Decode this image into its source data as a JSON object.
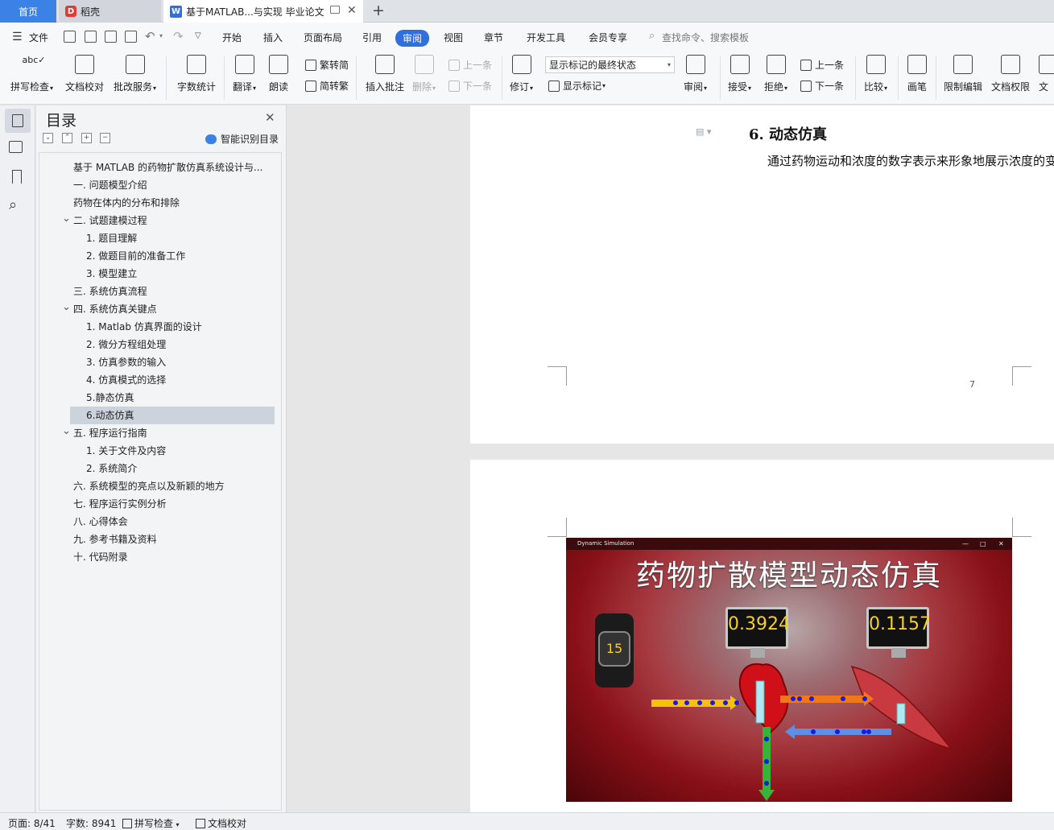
{
  "tabs": {
    "home": "首页",
    "daoke": "稻壳",
    "doc": "基于MATLAB...与实现 毕业论文",
    "add": "+"
  },
  "menu": {
    "file": "文件",
    "items": [
      "开始",
      "插入",
      "页面布局",
      "引用",
      "审阅",
      "视图",
      "章节",
      "开发工具",
      "会员专享"
    ],
    "active": "审阅",
    "search_placeholder": "查找命令、搜索模板"
  },
  "ribbon": {
    "spell": "拼写检查",
    "proofread": "文档校对",
    "batch": "批改服务",
    "wordcount": "字数统计",
    "translate": "翻译",
    "read": "朗读",
    "to_simp": "繁转简",
    "to_trad": "简转繁",
    "insert_comment": "插入批注",
    "delete": "删除",
    "prev_comment": "上一条",
    "next_comment": "下一条",
    "revise": "修订",
    "markup_state": "显示标记的最终状态",
    "show_markup": "显示标记",
    "review": "审阅",
    "accept": "接受",
    "reject": "拒绝",
    "prev": "上一条",
    "next": "下一条",
    "compare": "比较",
    "pen": "画笔",
    "restrict": "限制编辑",
    "permission": "文档权限",
    "doc_cut": "文"
  },
  "toc": {
    "title": "目录",
    "smart": "智能识别目录",
    "items": [
      {
        "text": "基于 MATLAB 的药物扩散仿真系统设计与...",
        "level": 0,
        "arrow": false
      },
      {
        "text": "一.   问题模型介绍",
        "level": 0,
        "arrow": false
      },
      {
        "text": "药物在体内的分布和排除",
        "level": 0,
        "arrow": false
      },
      {
        "text": "二. 试题建模过程",
        "level": 0,
        "arrow": true
      },
      {
        "text": "1. 题目理解",
        "level": 1,
        "arrow": false
      },
      {
        "text": "2. 做题目前的准备工作",
        "level": 1,
        "arrow": false
      },
      {
        "text": "3. 模型建立",
        "level": 1,
        "arrow": false
      },
      {
        "text": "三. 系统仿真流程",
        "level": 0,
        "arrow": false
      },
      {
        "text": "四. 系统仿真关键点",
        "level": 0,
        "arrow": true
      },
      {
        "text": "1. Matlab 仿真界面的设计",
        "level": 1,
        "arrow": false
      },
      {
        "text": "2. 微分方程组处理",
        "level": 1,
        "arrow": false
      },
      {
        "text": "3. 仿真参数的输入",
        "level": 1,
        "arrow": false
      },
      {
        "text": "4. 仿真模式的选择",
        "level": 1,
        "arrow": false
      },
      {
        "text": "5.静态仿真",
        "level": 1,
        "arrow": false
      },
      {
        "text": "6.动态仿真",
        "level": 1,
        "arrow": false,
        "selected": true
      },
      {
        "text": "五. 程序运行指南",
        "level": 0,
        "arrow": true
      },
      {
        "text": "1. 关于文件及内容",
        "level": 1,
        "arrow": false
      },
      {
        "text": "2. 系统简介",
        "level": 1,
        "arrow": false
      },
      {
        "text": "六. 系统模型的亮点以及新颖的地方",
        "level": 0,
        "arrow": false
      },
      {
        "text": "七.   程序运行实例分析",
        "level": 0,
        "arrow": false
      },
      {
        "text": "八.   心得体会",
        "level": 0,
        "arrow": false
      },
      {
        "text": "九. 参考书籍及资料",
        "level": 0,
        "arrow": false
      },
      {
        "text": "十. 代码附录",
        "level": 0,
        "arrow": false
      }
    ]
  },
  "doc": {
    "heading": "6.  动态仿真",
    "body": "通过药物运动和浓度的数字表示来形象地展示浓度的变化过程。",
    "page_number": "7"
  },
  "sim": {
    "window_title": "Dynamic Simulation",
    "title": "药物扩散模型动态仿真",
    "value1": "0.3924",
    "value2": "0.1157",
    "timer": "15"
  },
  "status": {
    "page": "页面: 8/41",
    "words": "字数: 8941",
    "spell": "拼写检查",
    "proof": "文档校对"
  },
  "colors": {
    "accent": "#2f6fde",
    "tab_home": "#3b82e6",
    "selected_toc": "#cdd3dc"
  }
}
